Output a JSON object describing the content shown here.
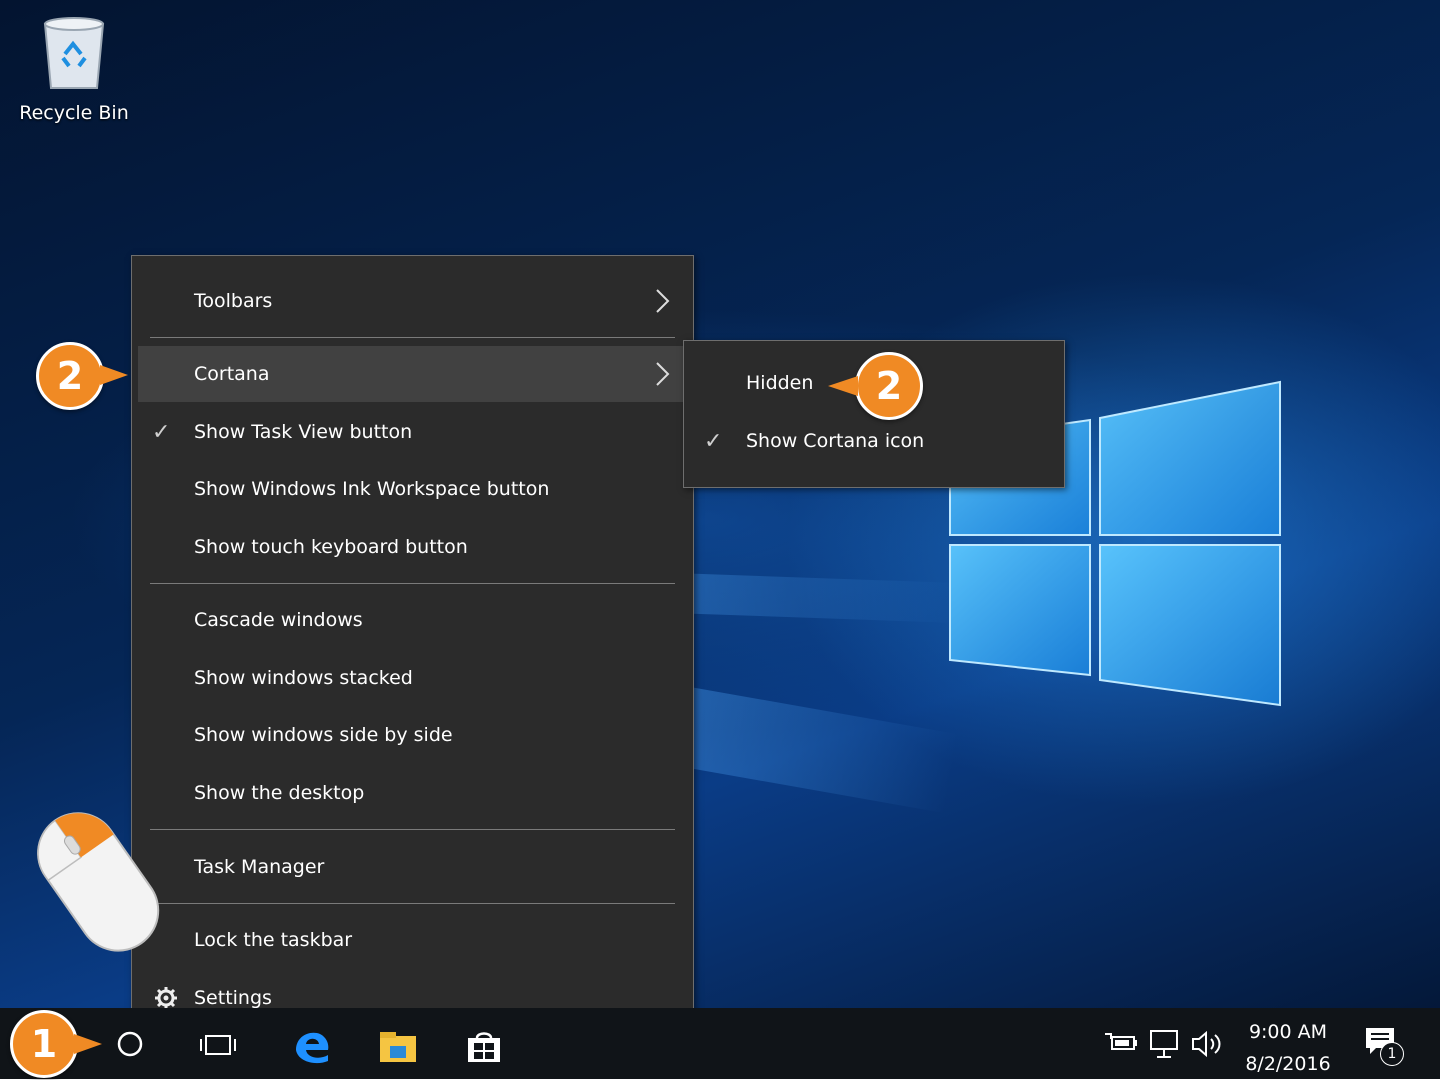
{
  "desktop": {
    "recycle_bin_label": "Recycle Bin"
  },
  "context_menu": {
    "items": [
      {
        "label": "Toolbars",
        "submenu": true
      },
      {
        "label": "Cortana",
        "submenu": true,
        "highlighted": true
      },
      {
        "label": "Show Task View button",
        "checked": true
      },
      {
        "label": "Show Windows Ink Workspace button"
      },
      {
        "label": "Show touch keyboard button"
      },
      {
        "label": "Cascade windows"
      },
      {
        "label": "Show windows stacked"
      },
      {
        "label": "Show windows side by side"
      },
      {
        "label": "Show the desktop"
      },
      {
        "label": "Task Manager"
      },
      {
        "label": "Lock the taskbar"
      },
      {
        "label": "Settings",
        "icon": "gear-icon"
      }
    ]
  },
  "cortana_submenu": {
    "items": [
      {
        "label": "Hidden"
      },
      {
        "label": "Show Cortana icon",
        "checked": true
      }
    ]
  },
  "taskbar": {
    "time": "9:00 AM",
    "date": "8/2/2016",
    "notification_count": "1",
    "pinned_icons": [
      "cortana-search-icon",
      "task-view-icon",
      "edge-icon",
      "file-explorer-icon",
      "store-icon"
    ],
    "tray_icons": [
      "power-icon",
      "network-icon",
      "volume-icon",
      "action-center-icon"
    ]
  },
  "callouts": {
    "step1": "1",
    "step2_menu": "2",
    "step2_submenu": "2"
  },
  "colors": {
    "callout": "#f08a24",
    "menu_bg": "#2b2b2b",
    "highlight": "#414141"
  }
}
